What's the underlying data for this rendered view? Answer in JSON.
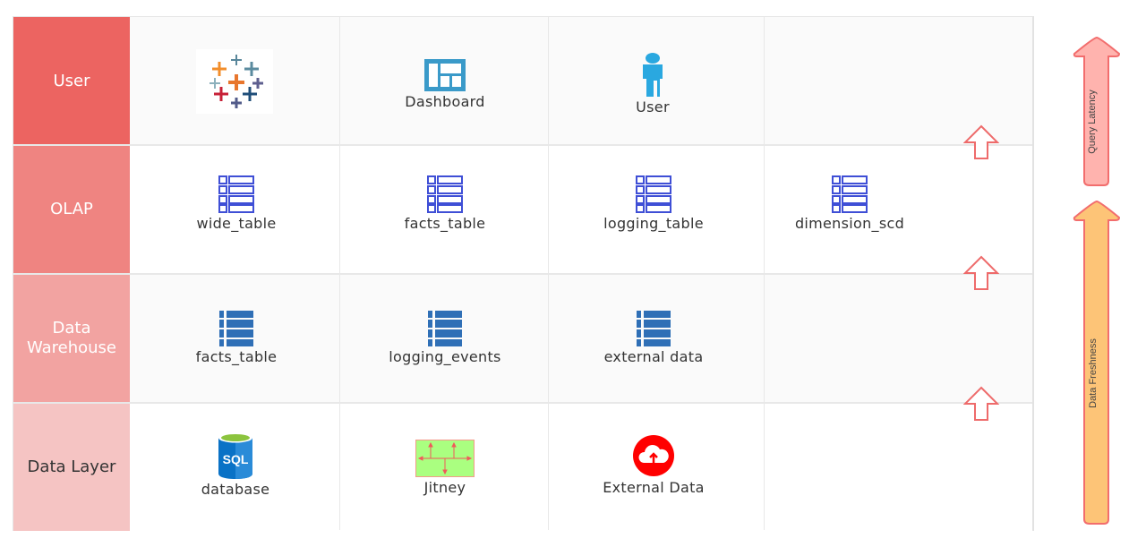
{
  "rows": [
    {
      "label": "User",
      "color": "#ec6461"
    },
    {
      "label": "OLAP",
      "color": "#ef8481"
    },
    {
      "label": "Data Warehouse",
      "color": "#f2a3a1"
    },
    {
      "label": "Data Layer",
      "color": "#f5c4c3"
    }
  ],
  "user_row": [
    {
      "icon": "tableau-logo-icon",
      "label": ""
    },
    {
      "icon": "dashboard-icon",
      "label": "Dashboard"
    },
    {
      "icon": "user-icon",
      "label": "User"
    }
  ],
  "olap_row": [
    {
      "icon": "table-outline-icon",
      "label": "wide_table"
    },
    {
      "icon": "table-outline-icon",
      "label": "facts_table"
    },
    {
      "icon": "table-outline-icon",
      "label": "logging_table"
    },
    {
      "icon": "table-outline-icon",
      "label": "dimension_scd"
    }
  ],
  "warehouse_row": [
    {
      "icon": "table-solid-icon",
      "label": "facts_table"
    },
    {
      "icon": "table-solid-icon",
      "label": "logging_events"
    },
    {
      "icon": "table-solid-icon",
      "label": "external data"
    }
  ],
  "data_row": [
    {
      "icon": "sql-database-icon",
      "label": "database"
    },
    {
      "icon": "jitney-icon",
      "label": "Jitney"
    },
    {
      "icon": "cloud-upload-icon",
      "label": "External Data"
    }
  ],
  "side_arrows": {
    "query_latency": {
      "label": "Query Latency",
      "color": "#ffb3ae"
    },
    "data_freshness": {
      "label": "Data Freshness",
      "color": "#fdc477"
    }
  },
  "colors": {
    "arrow_stroke": "#ee6b6b",
    "table_outline": "#3f4fd6",
    "table_solid": "#2f6fb6"
  }
}
